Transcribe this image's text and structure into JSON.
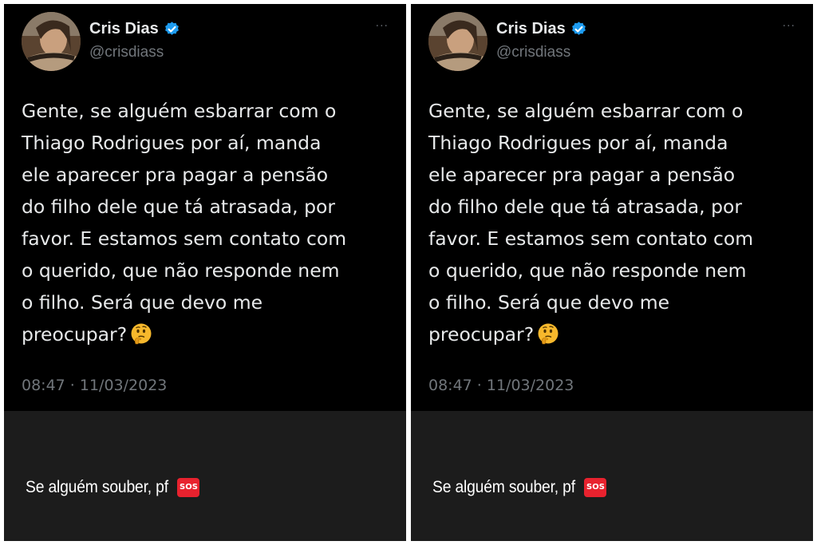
{
  "panels": [
    {
      "tweet": {
        "display_name": "Cris Dias",
        "handle": "@crisdiass",
        "more": "···",
        "text": "Gente, se alguém esbarrar com o\nThiago Rodrigues por aí, manda\nele aparecer pra pagar a pensão\ndo filho dele que tá atrasada, por\nfavor. E estamos sem contato com\no querido, que não responde nem\no filho. Será que devo me\npreocupar?",
        "emoji": "thinking-face",
        "timestamp": "08:47 · 11/03/2023"
      },
      "caption": {
        "text": "Se alguém souber, pf",
        "sticker": "SOS"
      }
    },
    {
      "tweet": {
        "display_name": "Cris Dias",
        "handle": "@crisdiass",
        "more": "···",
        "text": "Gente, se alguém esbarrar com o\nThiago Rodrigues por aí, manda\nele aparecer pra pagar a pensão\ndo filho dele que tá atrasada, por\nfavor. E estamos sem contato com\no querido, que não responde nem\no filho. Será que devo me\npreocupar?",
        "emoji": "thinking-face",
        "timestamp": "08:47 · 11/03/2023"
      },
      "caption": {
        "text": "Se alguém souber, pf",
        "sticker": "SOS"
      }
    }
  ],
  "colors": {
    "background": "#000000",
    "caption_bg": "#1c1c1c",
    "text_primary": "#e7e9ea",
    "text_secondary": "#71767b",
    "verified": "#1d9bf0",
    "sos": "#e8222e"
  }
}
